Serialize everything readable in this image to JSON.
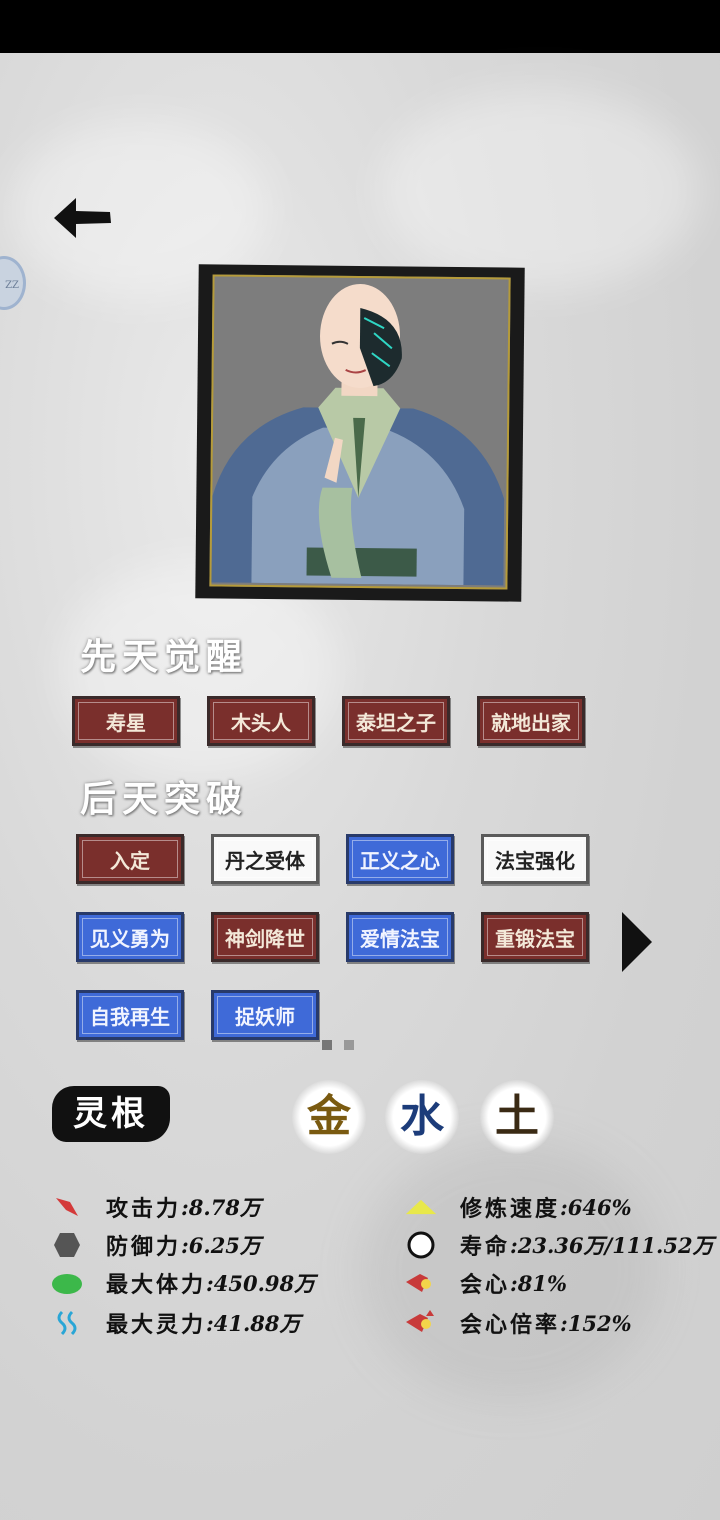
{
  "colors": {
    "red_tag": "#7a2f2c",
    "blue_tag": "#3f6ad8",
    "white_tag": "#f9f9f9",
    "element_gold": "#7a5a10",
    "element_water": "#1c3c7a",
    "element_earth": "#3a2a14"
  },
  "side_bubble": {
    "text": "ZZ"
  },
  "innate": {
    "title": "先天觉醒",
    "tags": [
      {
        "label": "寿星",
        "style": "red"
      },
      {
        "label": "木头人",
        "style": "red"
      },
      {
        "label": "泰坦之子",
        "style": "red"
      },
      {
        "label": "就地出家",
        "style": "red"
      }
    ]
  },
  "acquired": {
    "title": "后天突破",
    "tags": [
      {
        "label": "入定",
        "style": "red"
      },
      {
        "label": "丹之受体",
        "style": "white"
      },
      {
        "label": "正义之心",
        "style": "blue"
      },
      {
        "label": "法宝强化",
        "style": "white"
      },
      {
        "label": "见义勇为",
        "style": "blue"
      },
      {
        "label": "神剑降世",
        "style": "red"
      },
      {
        "label": "爱情法宝",
        "style": "blue"
      },
      {
        "label": "重锻法宝",
        "style": "red"
      },
      {
        "label": "自我再生",
        "style": "blue"
      },
      {
        "label": "捉妖师",
        "style": "blue"
      }
    ],
    "pagination": {
      "current": 1,
      "total": 2
    }
  },
  "linggen": {
    "label": "灵根",
    "elements": [
      "金",
      "水",
      "土"
    ]
  },
  "stats_left": [
    {
      "icon": "sword-icon",
      "label": "攻击力",
      "value": ":8.78万"
    },
    {
      "icon": "shield-icon",
      "label": "防御力",
      "value": ":6.25万"
    },
    {
      "icon": "heart-icon",
      "label": "最大体力",
      "value": ":450.98万"
    },
    {
      "icon": "spirit-wave-icon",
      "label": "最大灵力",
      "value": ":41.88万"
    }
  ],
  "stats_right": [
    {
      "icon": "triangle-icon",
      "label": "修炼速度",
      "value": ":646%"
    },
    {
      "icon": "circle-icon",
      "label": "寿命",
      "value": ":23.36万/111.52万"
    },
    {
      "icon": "critical-icon",
      "label": "会心",
      "value": ":81%"
    },
    {
      "icon": "critical-multiplier-icon",
      "label": "会心倍率",
      "value": ":152%"
    }
  ]
}
